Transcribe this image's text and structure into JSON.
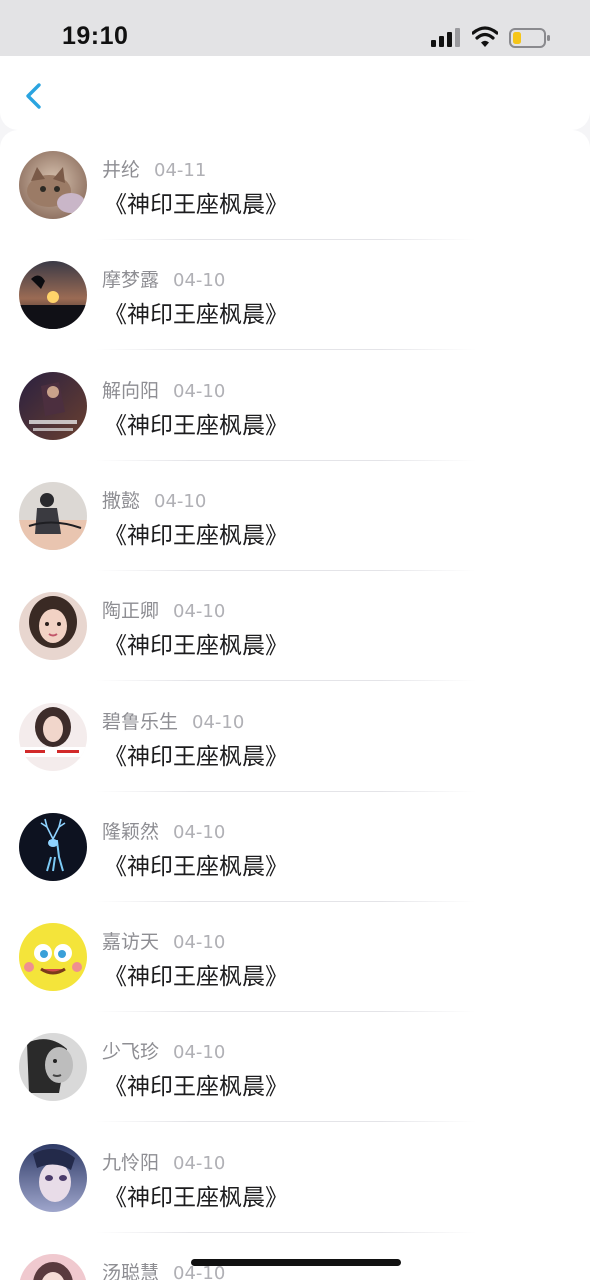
{
  "status_bar": {
    "time": "19:10",
    "signal_icon": "cellular-signal-icon",
    "wifi_icon": "wifi-icon",
    "battery_icon": "battery-low-icon",
    "battery_color": "#f5c518"
  },
  "nav": {
    "back_icon": "chevron-left-icon",
    "accent_color": "#2aa4e0"
  },
  "items": [
    {
      "name": "井纶",
      "date": "04-11",
      "title": "《神印王座枫晨》",
      "avatar": "cat-avatar"
    },
    {
      "name": "摩梦露",
      "date": "04-10",
      "title": "《神印王座枫晨》",
      "avatar": "sunset-avatar"
    },
    {
      "name": "解向阳",
      "date": "04-10",
      "title": "《神印王座枫晨》",
      "avatar": "game-poster-avatar"
    },
    {
      "name": "撒懿",
      "date": "04-10",
      "title": "《神印王座枫晨》",
      "avatar": "person-with-sign-avatar"
    },
    {
      "name": "陶正卿",
      "date": "04-10",
      "title": "《神印王座枫晨》",
      "avatar": "girl-portrait-avatar"
    },
    {
      "name": "碧鲁乐生",
      "date": "04-10",
      "title": "《神印王座枫晨》",
      "avatar": "girl-with-banner-avatar"
    },
    {
      "name": "隆颖然",
      "date": "04-10",
      "title": "《神印王座枫晨》",
      "avatar": "glowing-deer-avatar"
    },
    {
      "name": "嘉访天",
      "date": "04-10",
      "title": "《神印王座枫晨》",
      "avatar": "sponge-cartoon-avatar"
    },
    {
      "name": "少飞珍",
      "date": "04-10",
      "title": "《神印王座枫晨》",
      "avatar": "monochrome-girl-avatar"
    },
    {
      "name": "九怜阳",
      "date": "04-10",
      "title": "《神印王座枫晨》",
      "avatar": "anime-face-avatar"
    },
    {
      "name": "汤聪慧",
      "date": "04-10",
      "title": "",
      "avatar": "pink-portrait-avatar"
    }
  ]
}
